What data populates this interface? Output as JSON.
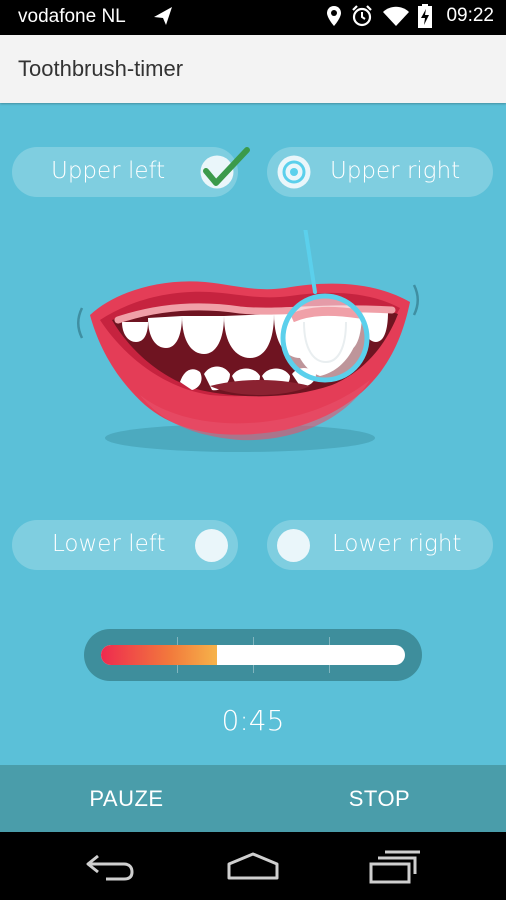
{
  "status_bar": {
    "carrier": "vodafone NL",
    "time": "09:22",
    "icons": [
      "location-icon",
      "alarm-icon",
      "wifi-icon",
      "battery-charging-icon"
    ]
  },
  "app": {
    "title": "Toothbrush-timer"
  },
  "zones": {
    "upper_left": {
      "label": "Upper left",
      "state": "done"
    },
    "upper_right": {
      "label": "Upper right",
      "state": "active"
    },
    "lower_left": {
      "label": "Lower left",
      "state": "pending"
    },
    "lower_right": {
      "label": "Lower right",
      "state": "pending"
    }
  },
  "progress": {
    "fraction": 0.38
  },
  "timer": {
    "value": "0:45"
  },
  "buttons": {
    "pause": "PAUZE",
    "stop": "STOP"
  },
  "nav": [
    "back-icon",
    "home-icon",
    "recents-icon"
  ],
  "colors": {
    "background": "#5bc0d8",
    "accent_line": "#5bd0ec",
    "check": "#3b9a4b",
    "lips": "#e43d57"
  }
}
